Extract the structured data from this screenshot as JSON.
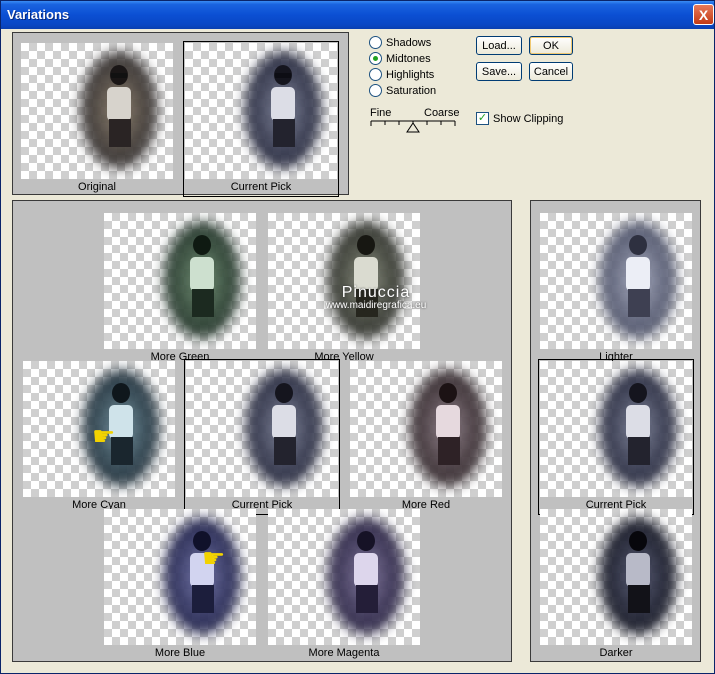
{
  "window": {
    "title": "Variations",
    "close_label": "X"
  },
  "top_panel": {
    "original_label": "Original",
    "current_pick_label": "Current Pick"
  },
  "options": {
    "tones": [
      {
        "label": "Shadows",
        "checked": false
      },
      {
        "label": "Midtones",
        "checked": true
      },
      {
        "label": "Highlights",
        "checked": false
      },
      {
        "label": "Saturation",
        "checked": false
      }
    ],
    "slider": {
      "fine_label": "Fine",
      "coarse_label": "Coarse"
    },
    "show_clipping": {
      "label": "Show Clipping",
      "checked": true
    }
  },
  "buttons": {
    "load": "Load...",
    "save": "Save...",
    "ok": "OK",
    "cancel": "Cancel"
  },
  "variations": {
    "more_green": "More Green",
    "more_yellow": "More Yellow",
    "more_cyan": "More Cyan",
    "current_pick": "Current Pick",
    "more_red": "More Red",
    "more_blue": "More Blue",
    "more_magenta": "More Magenta"
  },
  "brightness": {
    "lighter": "Lighter",
    "current_pick": "Current Pick",
    "darker": "Darker"
  },
  "watermark": {
    "name": "Pinuccia",
    "url": "www.maidiregrafica.eu"
  },
  "colors": {
    "titlebar": "#0b4fd3",
    "window_bg": "#ece9d8",
    "panel_bg": "#c0c0c0",
    "radio_dot": "#21a121"
  }
}
